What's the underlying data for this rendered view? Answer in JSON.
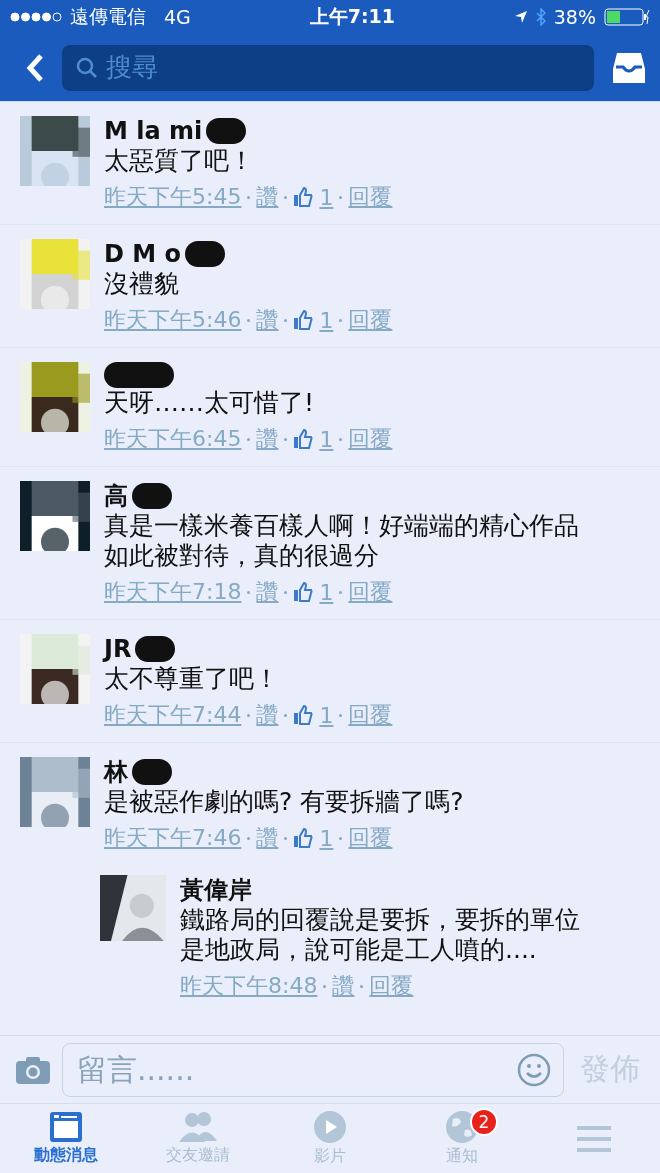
{
  "status_bar": {
    "carrier": "遠傳電信",
    "network": "4G",
    "time": "上午7:11",
    "battery": "38%"
  },
  "nav": {
    "search_placeholder": "搜尋"
  },
  "comments": [
    {
      "name": "M la mi",
      "text": "太惡質了吧！",
      "time": "昨天下午5:45",
      "like": "讚",
      "like_count": "1",
      "reply": "回覆"
    },
    {
      "name": "D M o",
      "text": "沒禮貌",
      "time": "昨天下午5:46",
      "like": "讚",
      "like_count": "1",
      "reply": "回覆"
    },
    {
      "text": "天呀……太可惜了!",
      "time": "昨天下午6:45",
      "like": "讚",
      "like_count": "1",
      "reply": "回覆"
    },
    {
      "name": "高",
      "text": "真是一樣米養百樣人啊！好端端的精心作品如此被對待，真的很過分",
      "time": "昨天下午7:18",
      "like": "讚",
      "like_count": "1",
      "reply": "回覆"
    },
    {
      "name": "JR",
      "text": "太不尊重了吧！",
      "time": "昨天下午7:44",
      "like": "讚",
      "like_count": "1",
      "reply": "回覆"
    },
    {
      "name": "林",
      "text": "是被惡作劇的嗎? 有要拆牆了嗎?",
      "time": "昨天下午7:46",
      "like": "讚",
      "like_count": "1",
      "reply": "回覆",
      "replies": [
        {
          "name": "黃偉岸",
          "text": "鐵路局的回覆說是要拆，要拆的單位是地政局，說可能是工人噴的....",
          "time": "昨天下午8:48",
          "like": "讚",
          "reply": "回覆"
        }
      ]
    }
  ],
  "composer": {
    "placeholder": "留言......",
    "send": "發佈",
    "send_disabled": true
  },
  "tabs": [
    {
      "kind": "news",
      "label": "動態消息",
      "selected": true
    },
    {
      "kind": "friends",
      "label": "交友邀請",
      "selected": false
    },
    {
      "kind": "video",
      "label": "影片",
      "selected": false
    },
    {
      "kind": "globe",
      "label": "通知",
      "selected": false,
      "badge": "2"
    },
    {
      "kind": "menu",
      "selected": false
    }
  ]
}
